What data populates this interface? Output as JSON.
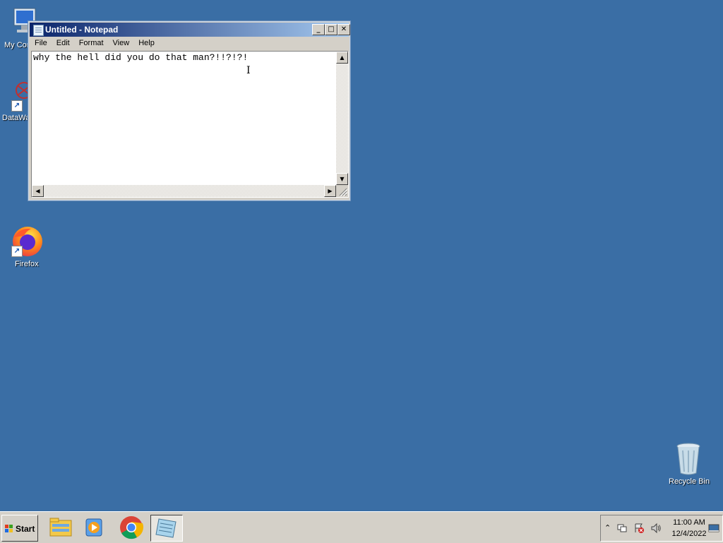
{
  "desktop": {
    "icons": [
      {
        "label": "My Con"
      },
      {
        "label": "DataWa"
      },
      {
        "label": "Firefox"
      },
      {
        "label": "Recycle Bin"
      }
    ]
  },
  "notepad": {
    "title": "Untitled - Notepad",
    "menu": [
      "File",
      "Edit",
      "Format",
      "View",
      "Help"
    ],
    "content": "why the hell did you do that man?!!?!?!"
  },
  "taskbar": {
    "start_label": "Start",
    "apps": [
      {
        "icon": "file-explorer-icon"
      },
      {
        "icon": "media-player-icon"
      },
      {
        "icon": "chrome-icon"
      },
      {
        "icon": "notepad-icon",
        "active": true
      }
    ],
    "clock_time": "11:00 AM",
    "clock_date": "12/4/2022"
  },
  "colors": {
    "desktop_bg": "#3a6ea5",
    "titlebar_start": "#0a246a",
    "titlebar_end": "#a6caf0"
  }
}
